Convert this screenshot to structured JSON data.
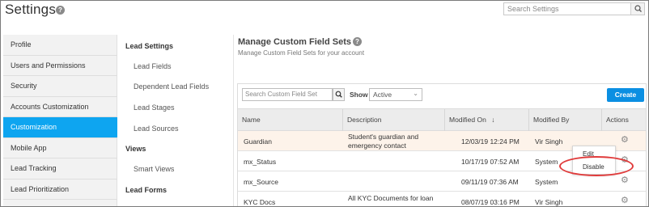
{
  "header": {
    "title": "Settings",
    "search_placeholder": "Search Settings"
  },
  "nav": {
    "items": [
      {
        "label": "Profile",
        "active": false
      },
      {
        "label": "Users and Permissions",
        "active": false
      },
      {
        "label": "Security",
        "active": false
      },
      {
        "label": "Accounts Customization",
        "active": false
      },
      {
        "label": "Customization",
        "active": true
      },
      {
        "label": "Mobile App",
        "active": false
      },
      {
        "label": "Lead Tracking",
        "active": false
      },
      {
        "label": "Lead Prioritization",
        "active": false
      }
    ],
    "accent": "#0ea5f0"
  },
  "subnav": {
    "lead_settings": "Lead Settings",
    "lead_fields": "Lead Fields",
    "dependent_lead_fields": "Dependent Lead Fields",
    "lead_stages": "Lead Stages",
    "lead_sources": "Lead Sources",
    "views": "Views",
    "smart_views": "Smart Views",
    "lead_forms": "Lead Forms"
  },
  "main": {
    "title": "Manage Custom Field Sets",
    "subtitle": "Manage Custom Field Sets for your account",
    "search_placeholder": "Search Custom Field Set",
    "show_label": "Show",
    "show_value": "Active",
    "create_label": "Create",
    "create_color": "#0b8fe2"
  },
  "table": {
    "columns": {
      "name": "Name",
      "description": "Description",
      "modified_on": "Modified On",
      "sort_arrow": "↓",
      "modified_by": "Modified By",
      "actions": "Actions"
    },
    "rows": [
      {
        "name": "Guardian",
        "description_line1": "Student's guardian and",
        "description_line2": "emergency contact",
        "modified_on": "12/03/19 12:24 PM",
        "modified_by": "Vir Singh"
      },
      {
        "name": "mx_Status",
        "description_line1": "",
        "description_line2": "",
        "modified_on": "10/17/19 07:52 AM",
        "modified_by": "System"
      },
      {
        "name": "mx_Source",
        "description_line1": "",
        "description_line2": "",
        "modified_on": "09/11/19 07:36 AM",
        "modified_by": "System"
      },
      {
        "name": "KYC Docs",
        "description_line1": "All KYC Documents for loan",
        "description_line2": "",
        "modified_on": "08/07/19 03:16 PM",
        "modified_by": "Vir Singh"
      }
    ]
  },
  "actions_menu": {
    "edit": "Edit",
    "disable": "Disable",
    "highlight_color": "#e03b3b"
  }
}
